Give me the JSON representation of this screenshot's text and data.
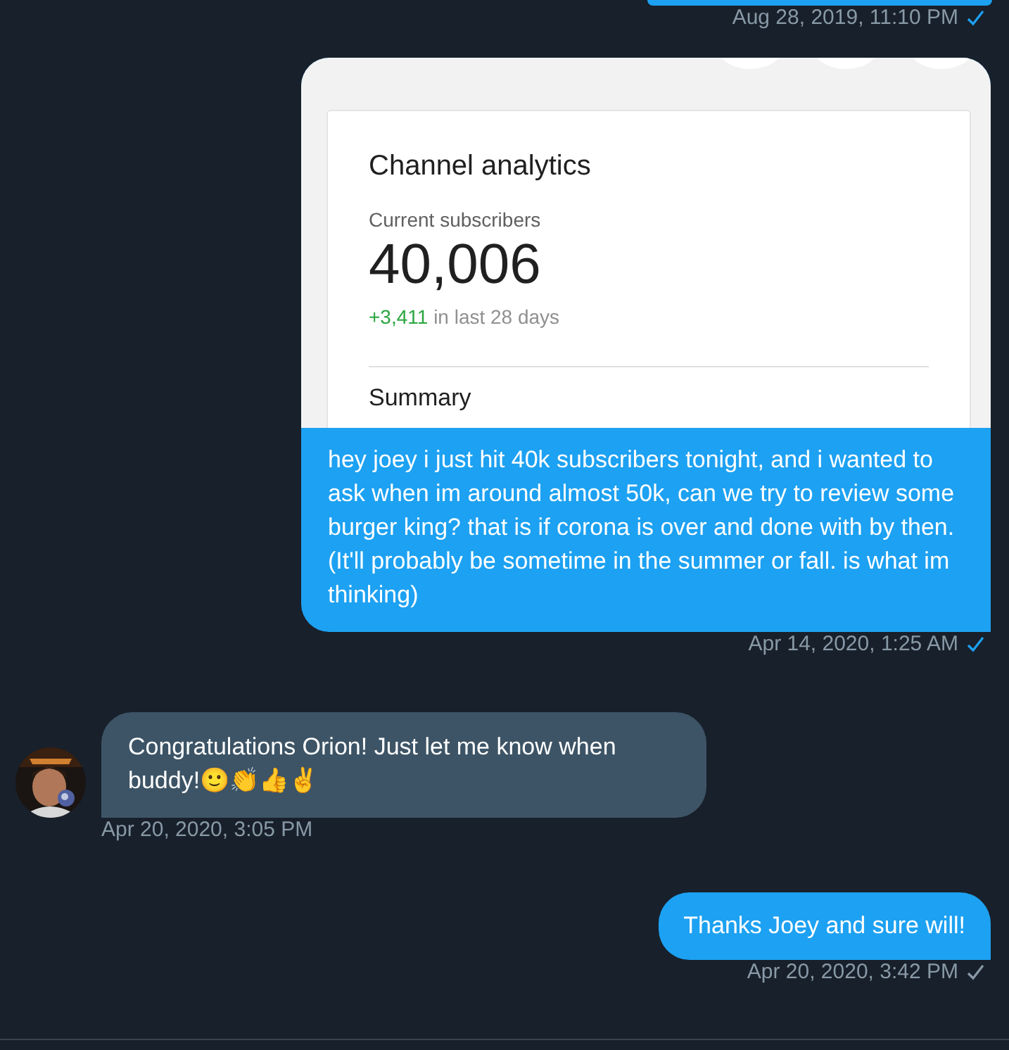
{
  "messages": [
    {
      "kind": "top-cut",
      "time": "Aug 28, 2019, 11:10 PM",
      "seen": true
    },
    {
      "kind": "sent-image",
      "image": {
        "title": "Channel analytics",
        "label": "Current subscribers",
        "count": "40,006",
        "change": "+3,411",
        "change_label": "in last 28 days",
        "section": "Summary"
      },
      "text": "hey joey i just hit 40k subscribers tonight, and i wanted to ask when im around almost 50k, can we try to review some burger king? that is if corona is over and done with by then. (It'll probably be sometime in the summer or fall. is what im thinking)",
      "time": "Apr 14, 2020, 1:25 AM",
      "seen": true
    },
    {
      "kind": "received",
      "text": "Congratulations Orion! Just let me know when buddy!🙂👏👍✌️",
      "time": "Apr 20, 2020, 3:05 PM"
    },
    {
      "kind": "sent",
      "text": "Thanks Joey and sure will!",
      "time": "Apr 20, 2020, 3:42 PM",
      "seen": false
    }
  ]
}
